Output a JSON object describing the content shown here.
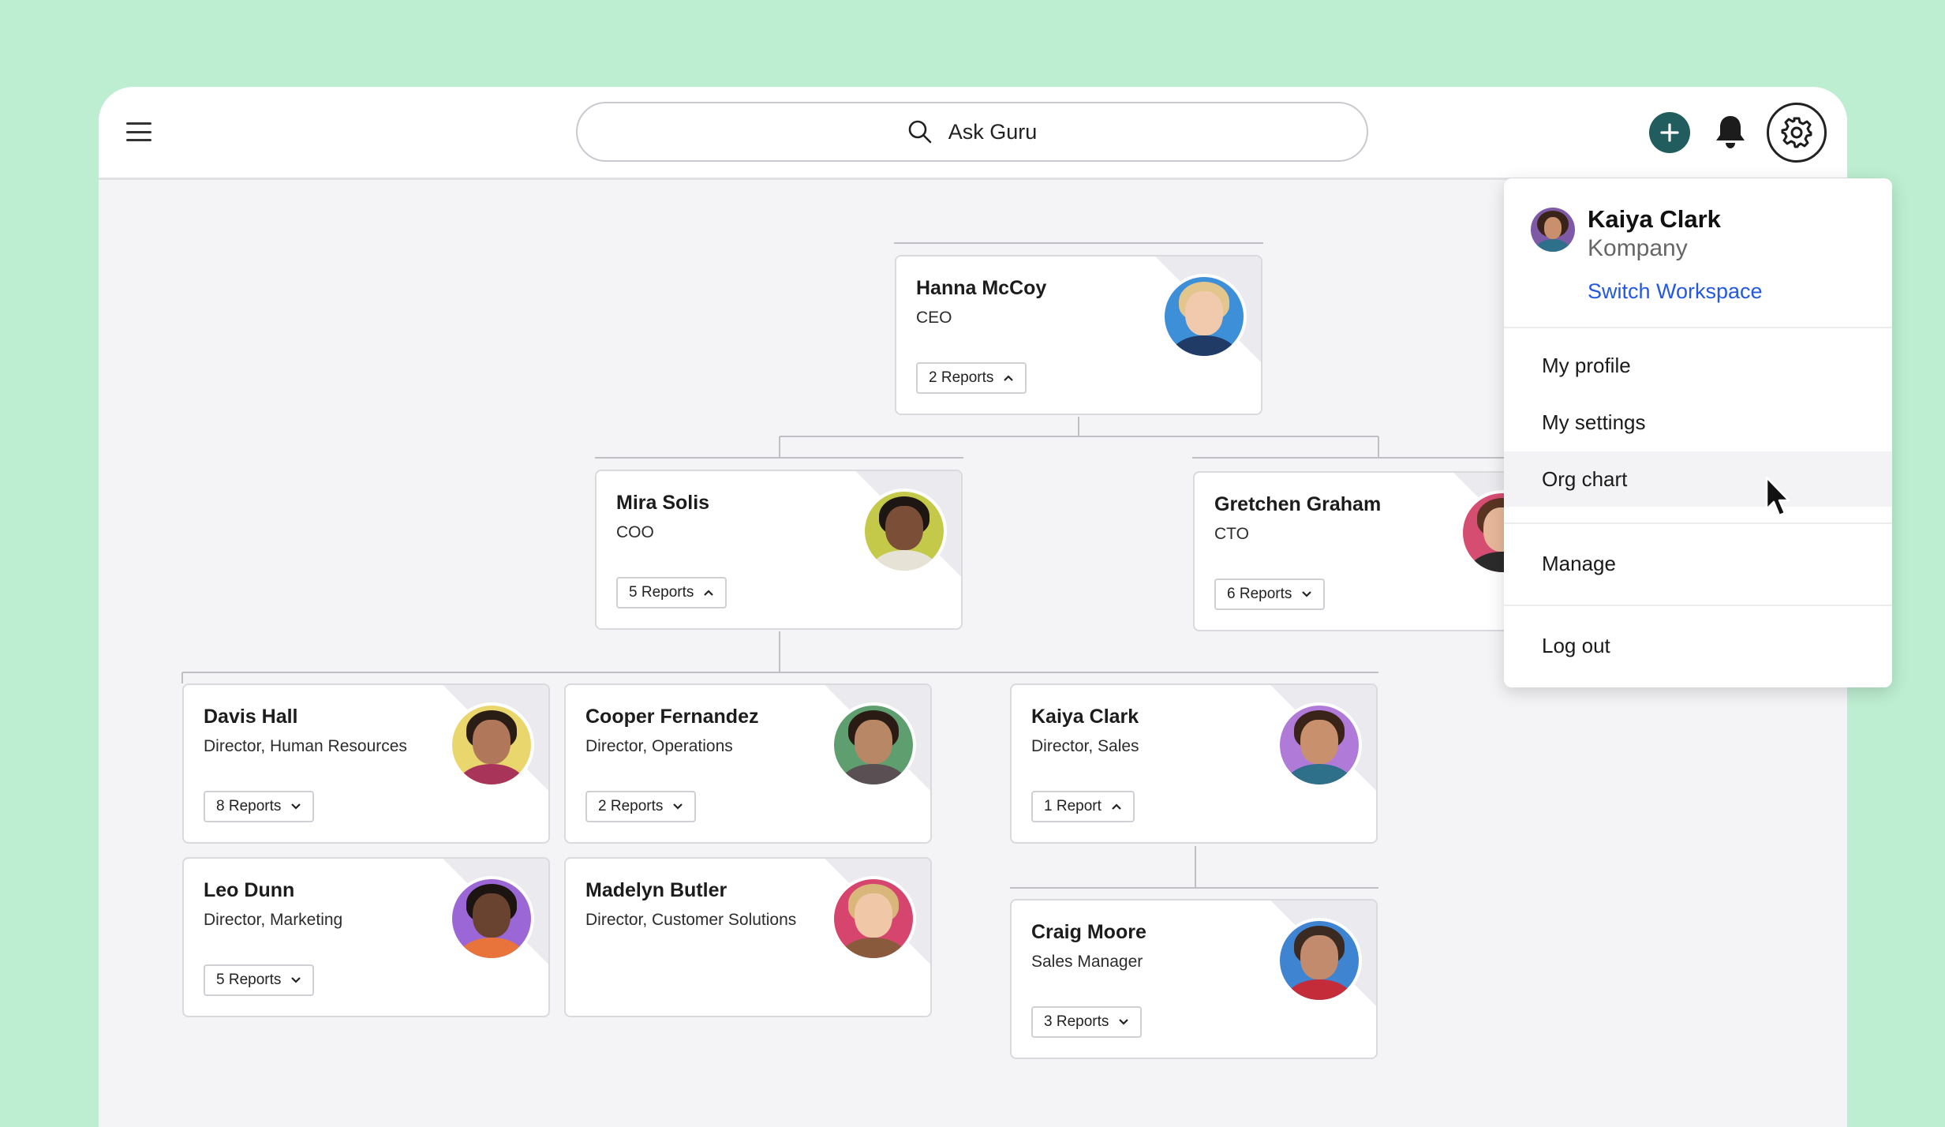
{
  "search": {
    "placeholder": "Ask Guru"
  },
  "colors": {
    "background": "#bdeed1",
    "accent": "#215c5f",
    "link": "#2458e0"
  },
  "icons": {
    "menu": "hamburger-icon",
    "search": "search-icon",
    "add": "plus-icon",
    "notifications": "bell-icon",
    "settings": "gear-icon"
  },
  "org": {
    "hanna": {
      "name": "Hanna McCoy",
      "title": "CEO",
      "reports": "2 Reports",
      "expanded": true
    },
    "mira": {
      "name": "Mira Solis",
      "title": "COO",
      "reports": "5 Reports",
      "expanded": true
    },
    "gretchen": {
      "name": "Gretchen Graham",
      "title": "CTO",
      "reports": "6 Reports",
      "expanded": false
    },
    "davis": {
      "name": "Davis Hall",
      "title": "Director, Human Resources",
      "reports": "8 Reports",
      "expanded": false
    },
    "cooper": {
      "name": "Cooper Fernandez",
      "title": "Director, Operations",
      "reports": "2 Reports",
      "expanded": false
    },
    "kaiya": {
      "name": "Kaiya Clark",
      "title": "Director, Sales",
      "reports": "1 Report",
      "expanded": true
    },
    "leo": {
      "name": "Leo Dunn",
      "title": "Director, Marketing",
      "reports": "5 Reports",
      "expanded": false
    },
    "madelyn": {
      "name": "Madelyn Butler",
      "title": "Director, Customer Solutions"
    },
    "craig": {
      "name": "Craig Moore",
      "title": "Sales Manager",
      "reports": "3 Reports",
      "expanded": false
    }
  },
  "user_menu": {
    "name": "Kaiya Clark",
    "workspace": "Kompany",
    "switch_label": "Switch Workspace",
    "items": [
      "My profile",
      "My settings",
      "Org chart",
      "Manage",
      "Log out"
    ],
    "hovered": "Org chart"
  }
}
